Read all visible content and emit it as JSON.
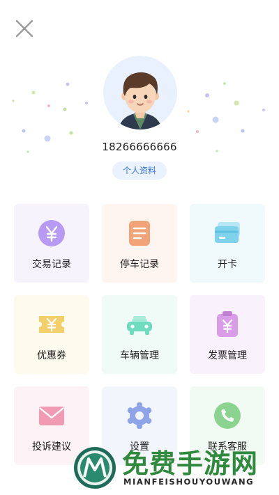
{
  "user": {
    "phone": "18266666666",
    "profile_button": "个人资料"
  },
  "menu": [
    {
      "label": "交易记录",
      "icon": "yen-circle-icon",
      "color": "#b79af3"
    },
    {
      "label": "停车记录",
      "icon": "document-icon",
      "color": "#f0a478"
    },
    {
      "label": "开卡",
      "icon": "card-icon",
      "color": "#7fd2ec"
    },
    {
      "label": "优惠券",
      "icon": "coupon-icon",
      "color": "#f3cf6a"
    },
    {
      "label": "车辆管理",
      "icon": "car-icon",
      "color": "#6fdcc0"
    },
    {
      "label": "发票管理",
      "icon": "invoice-icon",
      "color": "#d89de6"
    },
    {
      "label": "投诉建议",
      "icon": "mail-icon",
      "color": "#f19ab3"
    },
    {
      "label": "设置",
      "icon": "gear-icon",
      "color": "#8ea3e8"
    },
    {
      "label": "联系客服",
      "icon": "phone-icon",
      "color": "#8bd48f"
    }
  ],
  "watermark": {
    "title": "免费手游网",
    "subtitle": "MIANFEISHOUYOUWANG"
  }
}
